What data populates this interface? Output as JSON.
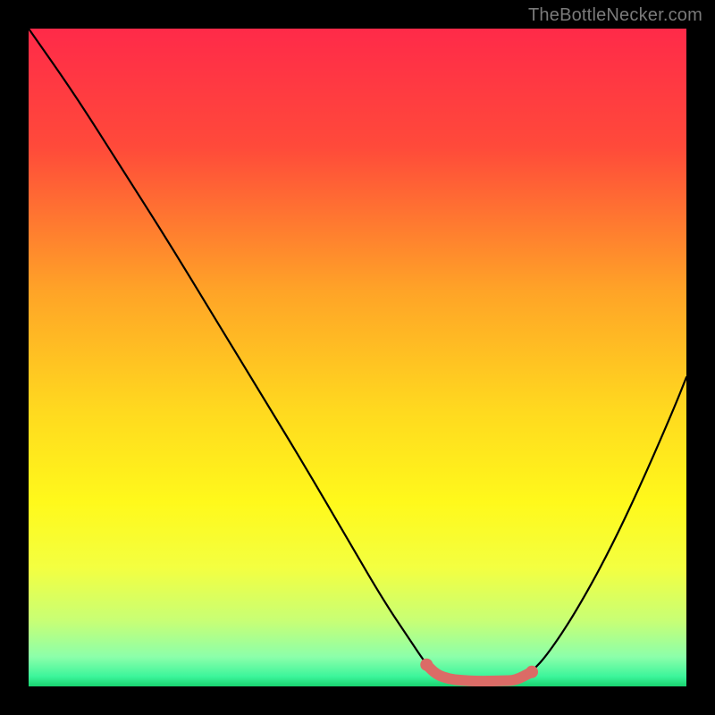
{
  "watermark": "TheBottleNecker.com",
  "chart_data": {
    "type": "line",
    "title": "",
    "xlabel": "",
    "ylabel": "",
    "xlim": [
      0,
      100
    ],
    "ylim": [
      0,
      100
    ],
    "gradient_stops": [
      {
        "offset": 0.0,
        "color": "#ff2a49"
      },
      {
        "offset": 0.18,
        "color": "#ff4a3a"
      },
      {
        "offset": 0.4,
        "color": "#ffa427"
      },
      {
        "offset": 0.58,
        "color": "#ffd91f"
      },
      {
        "offset": 0.72,
        "color": "#fff91b"
      },
      {
        "offset": 0.82,
        "color": "#f3ff41"
      },
      {
        "offset": 0.9,
        "color": "#c8ff75"
      },
      {
        "offset": 0.955,
        "color": "#8cffaa"
      },
      {
        "offset": 0.985,
        "color": "#3cf59b"
      },
      {
        "offset": 1.0,
        "color": "#18d26f"
      }
    ],
    "series": [
      {
        "name": "bottleneck-curve",
        "color": "#000000",
        "x": [
          0,
          7,
          14,
          21,
          28,
          35,
          42,
          49,
          54,
          58,
          60.5,
          62,
          65,
          70,
          74,
          76.5,
          79,
          83,
          88,
          93,
          98,
          100
        ],
        "values": [
          100,
          90,
          79,
          68,
          56.5,
          45,
          33.5,
          21.5,
          13,
          7,
          3.3,
          1.8,
          0.9,
          0.8,
          0.9,
          2.2,
          5,
          11,
          20,
          30.5,
          42,
          47
        ]
      },
      {
        "name": "valley-marker",
        "color": "#db6b66",
        "style": "thick-rounded",
        "x": [
          60.5,
          62,
          64,
          66,
          68,
          70,
          72,
          74,
          76.5
        ],
        "values": [
          3.3,
          1.8,
          1.1,
          0.9,
          0.8,
          0.8,
          0.85,
          0.9,
          2.2
        ]
      }
    ]
  }
}
